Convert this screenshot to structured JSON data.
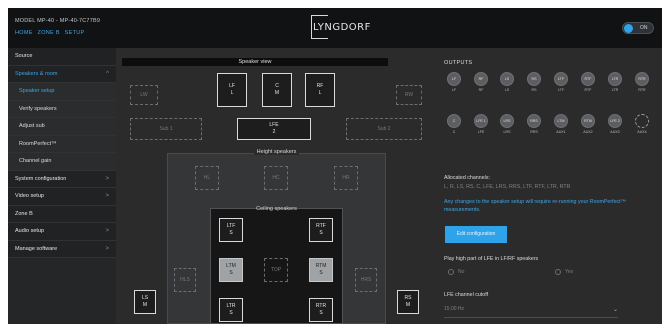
{
  "header": {
    "model": "MODEL MP-40 - MP-40-7C77B9",
    "breadcrumb": [
      "HOME",
      "ZONE B",
      "SETUP"
    ],
    "logo": "LYNGDORF",
    "power_toggle": "ON"
  },
  "sidebar": {
    "items": [
      {
        "label": "Source",
        "chevron": ""
      },
      {
        "label": "Speakers & room",
        "chevron": "^"
      },
      {
        "label": "Speaker setup",
        "chevron": ""
      },
      {
        "label": "Verify speakers",
        "chevron": ""
      },
      {
        "label": "Adjust sub",
        "chevron": ""
      },
      {
        "label": "RoomPerfect™",
        "chevron": ""
      },
      {
        "label": "Channel gain",
        "chevron": ""
      },
      {
        "label": "System configuration",
        "chevron": ">"
      },
      {
        "label": "Video setup",
        "chevron": ">"
      },
      {
        "label": "Zone B",
        "chevron": ""
      },
      {
        "label": "Audio setup",
        "chevron": ">"
      },
      {
        "label": "Manage software",
        "chevron": ">"
      }
    ]
  },
  "speaker_view": {
    "title": "Speaker view",
    "height_label": "Height speakers",
    "ceiling_label": "Ceiling speakers",
    "speakers": {
      "lw": "LW",
      "rw": "RW",
      "lf": [
        "LF",
        "L"
      ],
      "c": [
        "C",
        "M"
      ],
      "rf": [
        "RF",
        "L"
      ],
      "sub1": "Sub 1",
      "lfe": [
        "LFE",
        "2"
      ],
      "sub2": "Sub 2",
      "hl": "HL",
      "hc": "HC",
      "hr": "HR",
      "ltf": [
        "LTF",
        "S"
      ],
      "rtf": [
        "RTF",
        "S"
      ],
      "ltm": [
        "LTM",
        "S"
      ],
      "top": "TOP",
      "rtm": [
        "RTM",
        "S"
      ],
      "ltr": [
        "LTR",
        "S"
      ],
      "rtr": [
        "RTR",
        "S"
      ],
      "hls": "HLS",
      "hrs": "HRS",
      "ls": [
        "LS",
        "M"
      ],
      "rs": [
        "RS",
        "M"
      ]
    }
  },
  "outputs": {
    "title": "OUTPUTS",
    "row1": [
      {
        "circle": "LF",
        "label": "LF"
      },
      {
        "circle": "RF",
        "label": "RF"
      },
      {
        "circle": "LS",
        "label": "LS"
      },
      {
        "circle": "RS",
        "label": "RS"
      },
      {
        "circle": "LTF",
        "label": "LTF"
      },
      {
        "circle": "RTF",
        "label": "RTF"
      },
      {
        "circle": "LTR",
        "label": "LTR"
      },
      {
        "circle": "RTR",
        "label": "RTR"
      }
    ],
    "row2": [
      {
        "circle": "C",
        "label": "C"
      },
      {
        "circle": "LFE 1",
        "label": "LFE"
      },
      {
        "circle": "LRS",
        "label": "LRS"
      },
      {
        "circle": "RRS",
        "label": "RRS"
      },
      {
        "circle": "LTM",
        "label": "AUX1"
      },
      {
        "circle": "RTM",
        "label": "AUX2"
      },
      {
        "circle": "LFE 2",
        "label": "AUX3"
      },
      {
        "circle": "",
        "label": "AUX4"
      }
    ]
  },
  "info": {
    "allocated_title": "Allocated channels:",
    "allocated_list": "L, R, LS, RS, C, LFE, LRS, RRS, LTF, RTF, LTR, RTR",
    "warning": "Any changes to the speaker setup will require re-running your RoomPerfect™ measurements.",
    "edit_button": "Edit configuration",
    "play_high_label": "Play high part of LFE in LF/RF speakers",
    "radio_no": "No",
    "radio_yes": "Yes",
    "cutoff_label": "LFE channel cutoff",
    "cutoff_value": "15.00 Hz"
  },
  "colors": {
    "accent": "#2ea3ea",
    "background": "#2b2b2b",
    "header": "#111214"
  }
}
